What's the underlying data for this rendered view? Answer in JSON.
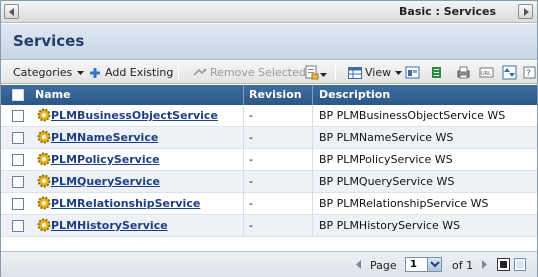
{
  "window": {
    "title": "Basic : Services"
  },
  "page": {
    "heading": "Services"
  },
  "toolbar": {
    "categories": "Categories",
    "add_existing": "Add Existing",
    "remove_selected": "Remove Selected",
    "view": "View"
  },
  "table": {
    "columns": {
      "name": "Name",
      "revision": "Revision",
      "description": "Description"
    },
    "rows": [
      {
        "name": "PLMBusinessObjectService",
        "revision": "-",
        "description": "BP PLMBusinessObjectService WS"
      },
      {
        "name": "PLMNameService",
        "revision": "-",
        "description": "BP PLMNameService WS"
      },
      {
        "name": "PLMPolicyService",
        "revision": "-",
        "description": "BP PLMPolicyService WS"
      },
      {
        "name": "PLMQueryService",
        "revision": "-",
        "description": "BP PLMQueryService WS"
      },
      {
        "name": "PLMRelationshipService",
        "revision": "-",
        "description": "BP PLMRelationshipService WS"
      },
      {
        "name": "PLMHistoryService",
        "revision": "-",
        "description": "BP PLMHistoryService WS"
      }
    ]
  },
  "pager": {
    "page_label": "Page",
    "current_page": "1",
    "of_label": "of 1"
  },
  "colors": {
    "header_blue": "#2c5786",
    "heading_text": "#23406a",
    "link": "#1d3f86"
  }
}
